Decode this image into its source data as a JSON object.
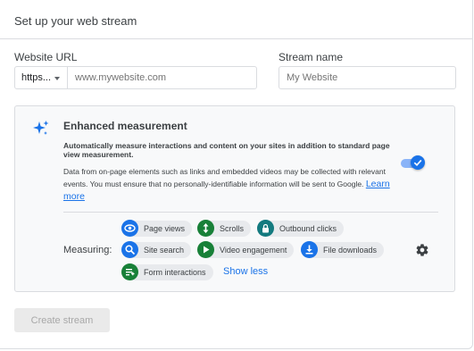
{
  "header": {
    "title": "Set up your web stream"
  },
  "website_url": {
    "label": "Website URL",
    "protocol": "https...",
    "placeholder": "www.mywebsite.com"
  },
  "stream_name": {
    "label": "Stream name",
    "placeholder": "My Website"
  },
  "enhanced": {
    "title": "Enhanced measurement",
    "desc_bold": "Automatically measure interactions and content on your sites in addition to standard page view measurement.",
    "desc": "Data from on-page elements such as links and embedded videos may be collected with relevant events. You must ensure that no personally-identifiable information will be sent to Google.",
    "learn_more": "Learn more",
    "toggle_on": true,
    "measuring_label": "Measuring:",
    "chips": [
      {
        "label": "Page views",
        "icon": "eye-icon",
        "color": "#1a73e8"
      },
      {
        "label": "Scrolls",
        "icon": "scroll-icon",
        "color": "#188038"
      },
      {
        "label": "Outbound clicks",
        "icon": "lock-icon",
        "color": "#137a7f"
      },
      {
        "label": "Site search",
        "icon": "search-icon",
        "color": "#1a73e8"
      },
      {
        "label": "Video engagement",
        "icon": "play-icon",
        "color": "#188038"
      },
      {
        "label": "File downloads",
        "icon": "download-icon",
        "color": "#1a73e8"
      },
      {
        "label": "Form interactions",
        "icon": "form-icon",
        "color": "#188038"
      }
    ],
    "show_less": "Show less"
  },
  "create_button": "Create stream",
  "colors": {
    "accent": "#1a73e8",
    "green": "#188038",
    "teal": "#137a7f"
  }
}
